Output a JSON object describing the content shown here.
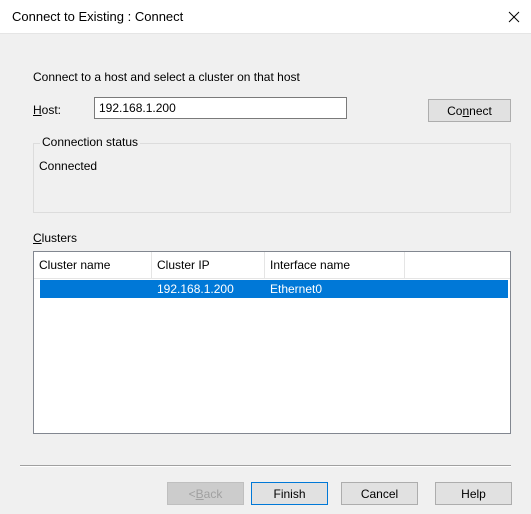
{
  "window": {
    "title": "Connect to Existing : Connect"
  },
  "intro_text": "Connect to a host and select a cluster on that host",
  "host": {
    "label_first": "H",
    "label_rest": "ost:",
    "value": "192.168.1.200"
  },
  "connect_button": {
    "pre": "Co",
    "key": "n",
    "post": "nect"
  },
  "connection_status": {
    "legend": "Connection status",
    "value": "Connected"
  },
  "clusters": {
    "label_first": "C",
    "label_rest": "lusters",
    "columns": [
      "Cluster name",
      "Cluster IP",
      "Interface name"
    ],
    "rows": [
      {
        "name": "",
        "ip": "192.168.1.200",
        "interface": "Ethernet0",
        "selected": true
      }
    ]
  },
  "buttons": {
    "back": {
      "pre": "< ",
      "key": "B",
      "post": "ack"
    },
    "finish": "Finish",
    "cancel": "Cancel",
    "help": "Help"
  },
  "colors": {
    "selection": "#0078d7",
    "dialog_bg": "#f0f0f0"
  },
  "icons": {
    "close": "close-icon"
  }
}
